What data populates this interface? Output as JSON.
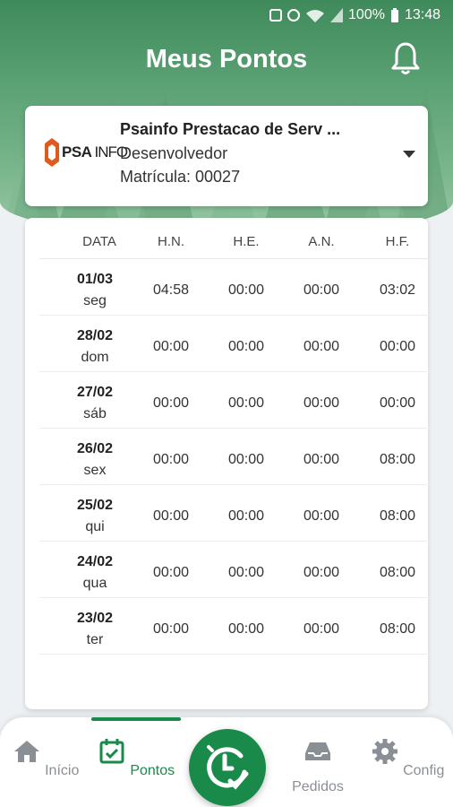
{
  "status": {
    "battery": "100%",
    "time": "13:48"
  },
  "header": {
    "title": "Meus Pontos"
  },
  "company": {
    "logo_psa": "PSA",
    "logo_info": "INFO",
    "name": "Psainfo Prestacao de Serv ...",
    "role": "Desenvolvedor",
    "matricula": "Matrícula: 00027"
  },
  "table": {
    "headers": [
      "DATA",
      "H.N.",
      "H.E.",
      "A.N.",
      "H.F."
    ],
    "rows": [
      {
        "date": "01/03",
        "day": "seg",
        "hn": "04:58",
        "he": "00:00",
        "an": "00:00",
        "hf": "03:02"
      },
      {
        "date": "28/02",
        "day": "dom",
        "hn": "00:00",
        "he": "00:00",
        "an": "00:00",
        "hf": "00:00"
      },
      {
        "date": "27/02",
        "day": "sáb",
        "hn": "00:00",
        "he": "00:00",
        "an": "00:00",
        "hf": "00:00"
      },
      {
        "date": "26/02",
        "day": "sex",
        "hn": "00:00",
        "he": "00:00",
        "an": "00:00",
        "hf": "08:00"
      },
      {
        "date": "25/02",
        "day": "qui",
        "hn": "00:00",
        "he": "00:00",
        "an": "00:00",
        "hf": "08:00"
      },
      {
        "date": "24/02",
        "day": "qua",
        "hn": "00:00",
        "he": "00:00",
        "an": "00:00",
        "hf": "08:00"
      },
      {
        "date": "23/02",
        "day": "ter",
        "hn": "00:00",
        "he": "00:00",
        "an": "00:00",
        "hf": "08:00"
      }
    ]
  },
  "nav": {
    "inicio": "Início",
    "pontos": "Pontos",
    "pedidos": "Pedidos",
    "config": "Config"
  },
  "colors": {
    "primary": "#1a8a4a",
    "hero": "#4f9a68"
  }
}
